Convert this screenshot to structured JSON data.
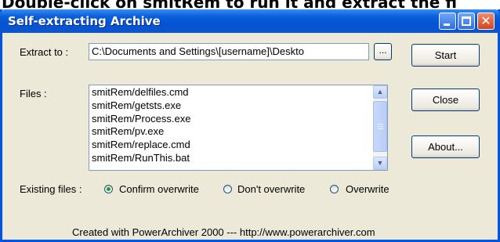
{
  "caption": {
    "prefix": "Double-click on ",
    "highlight": "smitRem",
    "suffix": " to run it and extract the fi"
  },
  "window": {
    "title": "Self-extracting Archive",
    "extract_to_label": "Extract to :",
    "extract_to_value": "C:\\Documents and Settings\\[username]\\Deskto",
    "browse_label": "...",
    "files_label": "Files :",
    "files": [
      "smitRem/delfiles.cmd",
      "smitRem/getsts.exe",
      "smitRem/Process.exe",
      "smitRem/pv.exe",
      "smitRem/replace.cmd",
      "smitRem/RunThis.bat"
    ],
    "buttons": {
      "start": "Start",
      "close": "Close",
      "about": "About..."
    },
    "existing_files": {
      "label": "Existing files :",
      "options": [
        "Confirm overwrite",
        "Don't overwrite",
        "Overwrite"
      ],
      "selected": "Confirm overwrite"
    },
    "footer": "Created with PowerArchiver 2000 --- http://www.powerarchiver.com"
  }
}
